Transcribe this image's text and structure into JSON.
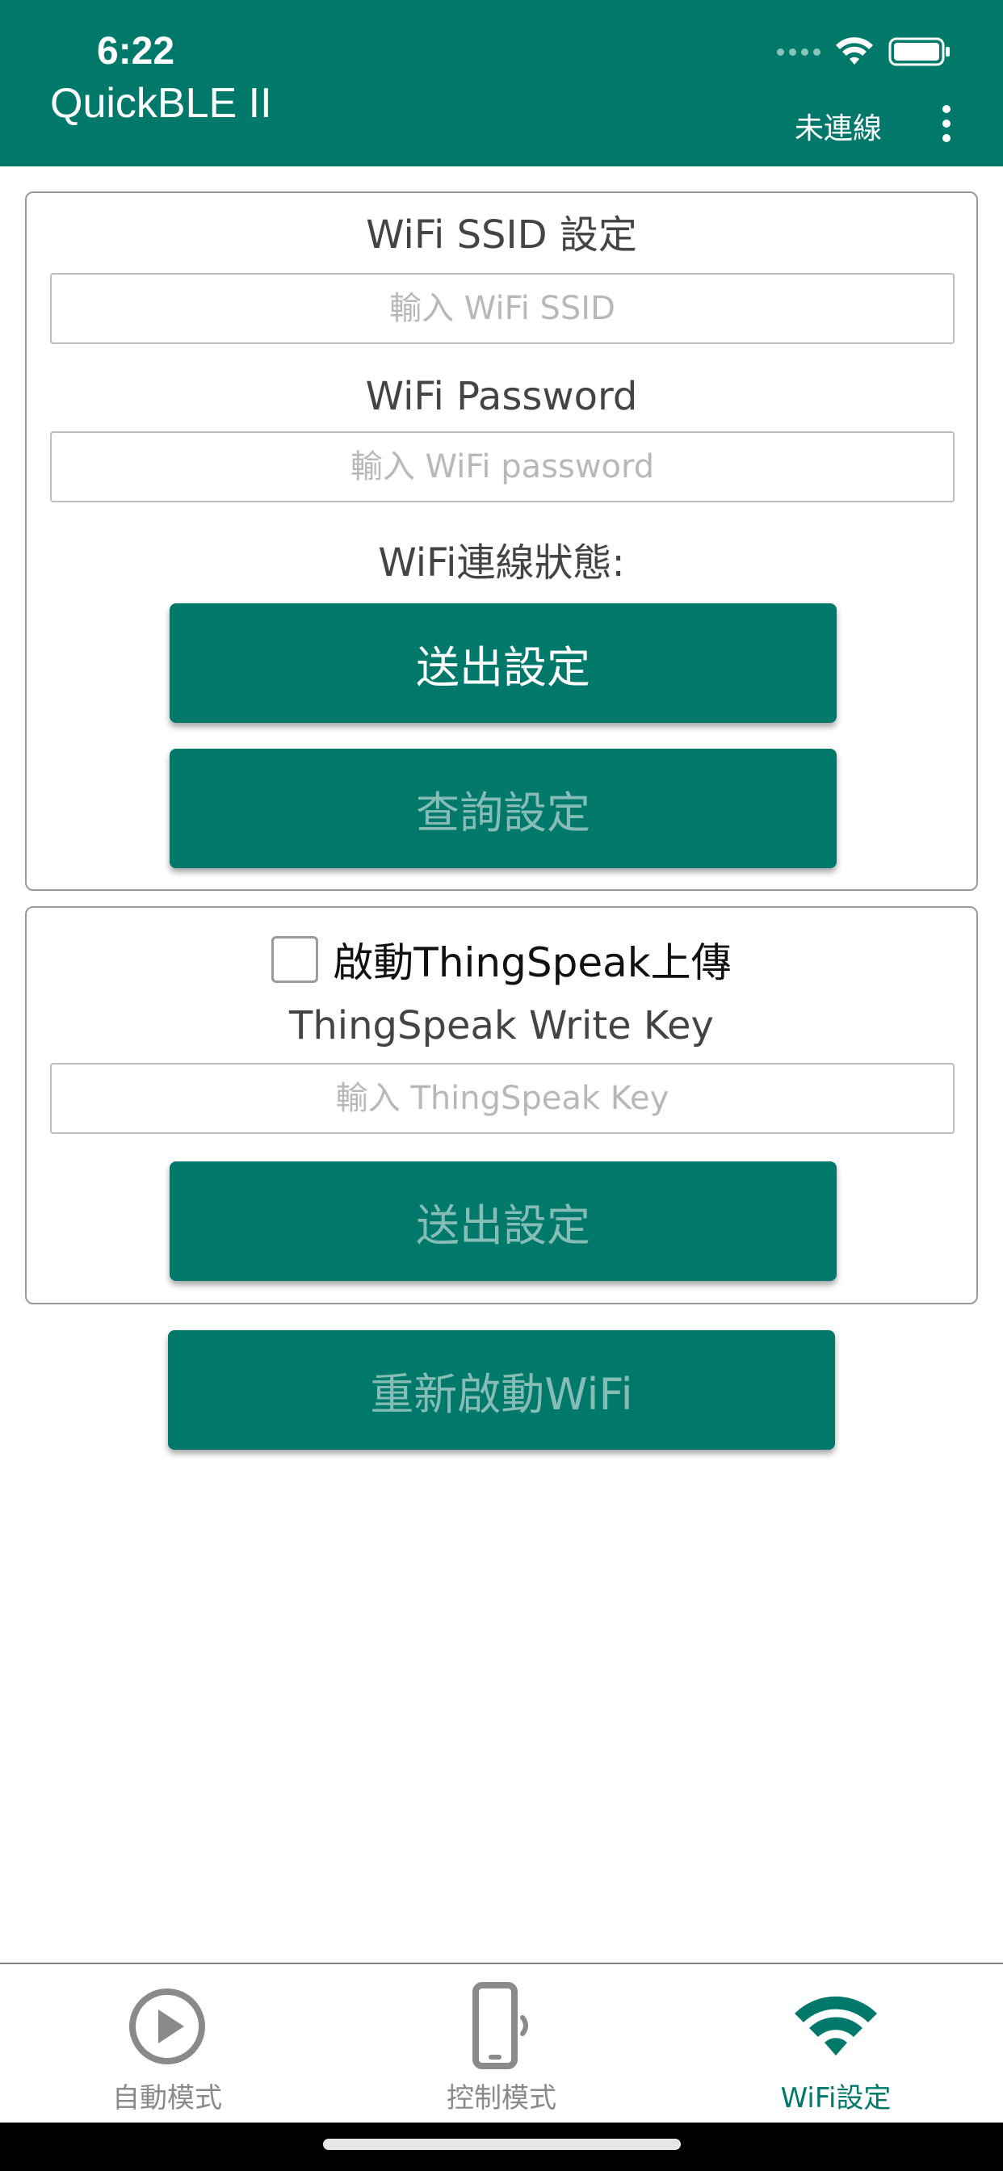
{
  "status_bar": {
    "time": "6:22"
  },
  "header": {
    "title": "QuickBLE II",
    "connection_status": "未連線",
    "menu_icon": "more-vertical-icon"
  },
  "wifi_card": {
    "ssid_label": "WiFi SSID 設定",
    "ssid_placeholder": "輸入 WiFi SSID",
    "ssid_value": "",
    "password_label": "WiFi Password",
    "password_placeholder": "輸入 WiFi password",
    "password_value": "",
    "status_label": "WiFi連線狀態:",
    "send_button": "送出設定",
    "query_button": "查詢設定"
  },
  "thingspeak_card": {
    "enable_label": "啟動ThingSpeak上傳",
    "enable_checked": false,
    "key_label": "ThingSpeak Write Key",
    "key_placeholder": "輸入 ThingSpeak Key",
    "key_value": "",
    "send_button": "送出設定"
  },
  "restart_button": "重新啟動WiFi",
  "tabs": [
    {
      "label": "自動模式",
      "icon": "play-circle-icon",
      "selected": false
    },
    {
      "label": "控制模式",
      "icon": "phone-vibrate-icon",
      "selected": false
    },
    {
      "label": "WiFi設定",
      "icon": "wifi-icon",
      "selected": true
    }
  ],
  "colors": {
    "primary": "#00796b",
    "disabled_text": "#85bdb6",
    "tab_inactive": "#8a8a8a"
  }
}
